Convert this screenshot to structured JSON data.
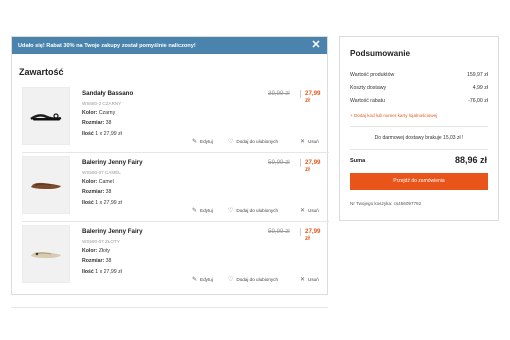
{
  "banner": {
    "text": "Udało się! Rabat 30% na Twoje zakupy został pomyślnie naliczony!",
    "close_icon": "close-icon",
    "color": "#4a83ac"
  },
  "cart": {
    "title": "Zawartość",
    "items": [
      {
        "name": "Sandały Bassano",
        "sku": "WS680-2 CZARNY",
        "color_label": "Kolor:",
        "color_value": "Czarny",
        "size_label": "Rozmiar:",
        "size_value": "38",
        "qty_label": "Ilość",
        "qty_value": "1 x 27,99 zł",
        "old_price": "39,99 zł",
        "new_price": "27,99 zł",
        "edit_label": "Edytuj",
        "fav_label": "Dodaj do ulubionych",
        "remove_label": "Usuń"
      },
      {
        "name": "Baleriny Jenny Fairy",
        "sku": "WS590-07 CAMEL",
        "color_label": "Kolor:",
        "color_value": "Camel",
        "size_label": "Rozmiar:",
        "size_value": "38",
        "qty_label": "Ilość",
        "qty_value": "1 x 27,99 zł",
        "old_price": "59,99 zł",
        "new_price": "27,99 zł",
        "edit_label": "Edytuj",
        "fav_label": "Dodaj do ulubionych",
        "remove_label": "Usuń"
      },
      {
        "name": "Baleriny Jenny Fairy",
        "sku": "WS590-07 ZŁOTY",
        "color_label": "Kolor:",
        "color_value": "Złoty",
        "size_label": "Rozmiar:",
        "size_value": "38",
        "qty_label": "Ilość",
        "qty_value": "1 x 27,99 zł",
        "old_price": "59,99 zł",
        "new_price": "27,99 zł",
        "edit_label": "Edytuj",
        "fav_label": "Dodaj do ulubionych",
        "remove_label": "Usuń"
      }
    ]
  },
  "summary": {
    "title": "Podsumowanie",
    "rows": [
      {
        "label": "Wartość produktów",
        "value": "159,97 zł"
      },
      {
        "label": "Koszty dostawy",
        "value": "4,99 zł"
      },
      {
        "label": "Wartość rabatu",
        "value": "-76,00 zł"
      }
    ],
    "discount_link": "+ Dodaj kod lub numer karty lojalnościowej",
    "free_shipping": "Do darmowej dostawy brakuje 15,03 zł !",
    "total_label": "Suma",
    "total_value": "88,96 zł",
    "checkout_label": "Przejdź do zamówienia",
    "basket_id": "Nr Twojego koszyka: cs456097792",
    "accent": "#e8541a"
  }
}
